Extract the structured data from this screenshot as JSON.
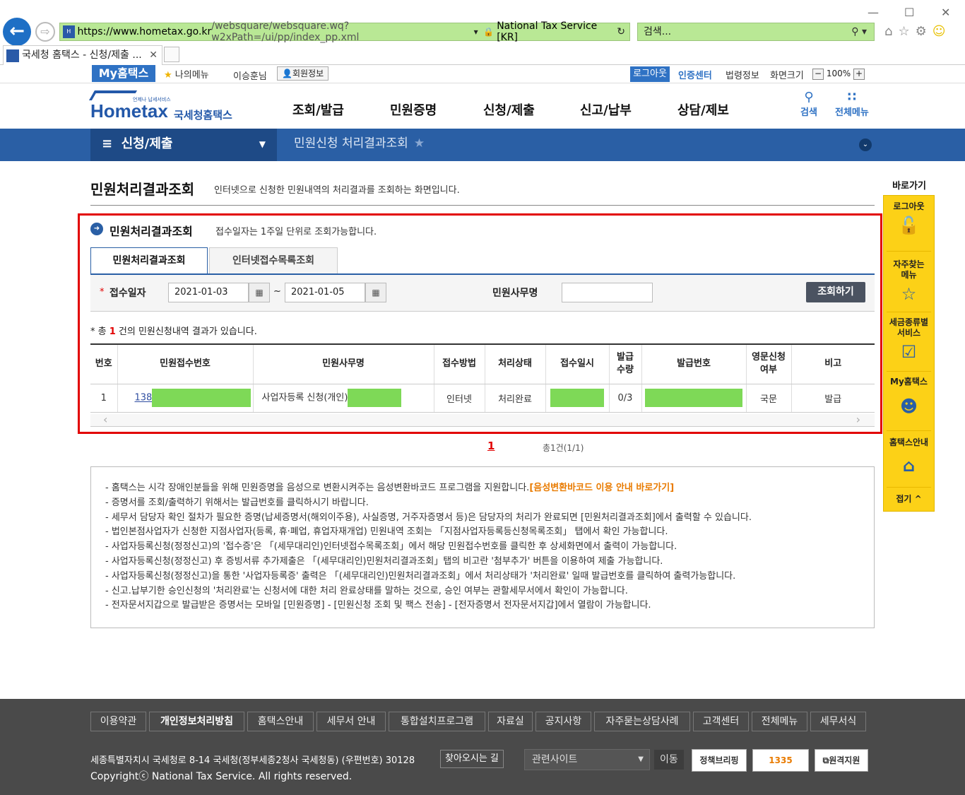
{
  "browser": {
    "url_base": "https://www.hometax.go.kr",
    "url_rest": "/websquare/websquare.wq?w2xPath=/ui/pp/index_pp.xml",
    "site_id": "National Tax Service [KR]",
    "search_placeholder": "검색...",
    "tab_title": "국세청 홈택스 - 신청/제출 ..."
  },
  "util": {
    "myhome": "My홈택스",
    "mymenu": "나의메뉴",
    "username": "이승훈님",
    "member_info": "회원정보",
    "logout": "로그아웃",
    "cert_center": "인증센터",
    "law_info": "법령정보",
    "screen_size": "화면크기",
    "zoom": "100%"
  },
  "header": {
    "logo_main": "Hometax",
    "logo_kr": "국세청홈택스",
    "logo_tiny": "언제나 납세서비스",
    "nav": [
      "조회/발급",
      "민원증명",
      "신청/제출",
      "신고/납부",
      "상담/제보"
    ],
    "search": "검색",
    "all_menu": "전체메뉴"
  },
  "location": {
    "section": "신청/제출",
    "page": "민원신청 처리결과조회"
  },
  "page": {
    "title": "민원처리결과조회",
    "desc": "인터넷으로 신청한 민원내역의 처리결과를 조회하는 화면입니다."
  },
  "section": {
    "title": "민원처리결과조회",
    "note": "접수일자는 1주일 단위로 조회가능합니다.",
    "tabs": [
      "민원처리결과조회",
      "인터넷접수목록조회"
    ],
    "form": {
      "date_label": "접수일자",
      "date_from": "2021-01-03",
      "date_to": "2021-01-05",
      "tilde": "~",
      "task_label": "민원사무명",
      "task_value": "",
      "search_btn": "조회하기"
    },
    "result": {
      "prefix": "* 총",
      "count": "1",
      "suffix": "건의 민원신청내역 결과가 있습니다."
    },
    "table": {
      "headers": [
        "번호",
        "민원접수번호",
        "민원사무명",
        "접수방법",
        "처리상태",
        "접수일시",
        "발급\n수량",
        "발급번호",
        "영문신청\n여부",
        "비고"
      ],
      "rows": [
        {
          "no": "1",
          "receipt_no": "138",
          "task": "사업자등록 신청(개인)",
          "method": "인터넷",
          "status": "처리완료",
          "qty": "0/3",
          "english": "국문",
          "note": "발급"
        }
      ]
    },
    "pager": {
      "current": "1",
      "info": "총1건(1/1)"
    }
  },
  "notes": [
    "- 홈택스는 시각 장애인분들을 위해 민원증명을 음성으로 변환시켜주는 음성변환바코드 프로그램을 지원합니다.",
    "[음성변환바코드 이용 안내 바로가기]",
    "- 증명서를 조회/출력하기 위해서는 발급번호를 클릭하시기 바랍니다.",
    "- 세무서 담당자 확인 절차가 필요한 증명(납세증명서(해외이주용), 사실증명, 거주자증명서 등)은 담당자의 처리가 완료되면 [민원처리결과조회]에서 출력할 수 있습니다.",
    "- 법인본점사업자가 신청한 지점사업자(등록, 휴·폐업, 휴업자재개업) 민원내역 조회는 「지점사업자등록등신청목록조회」 탭에서 확인 가능합니다.",
    "- 사업자등록신청(정정신고)의 '접수증'은 「(세무대리인)인터넷접수목록조회」에서 해당 민원접수번호를 클릭한 후 상세화면에서 출력이 가능합니다.",
    "- 사업자등록신청(정정신고) 후 증빙서류 추가제출은 「(세무대리인)민원처리결과조회」탭의 비고란 '첨부추가' 버튼을 이용하여 제출 가능합니다.",
    "- 사업자등록신청(정정신고)을 통한 '사업자등록증' 출력은 「(세무대리인)민원처리결과조회」에서 처리상태가 '처리완료' 일때 발급번호를 클릭하여 출력가능합니다.",
    "- 신고.납부기한 승인신청의 '처리완료'는 신청서에 대한 처리 완료상태를 말하는 것으로, 승인 여부는 관할세무서에서 확인이 가능합니다.",
    "- 전자문서지갑으로 발급받은 증명서는 모바일 [민원증명] - [민원신청 조회 및 팩스 전송] - [전자증명서 전자문서지갑]에서 열람이 가능합니다."
  ],
  "quick": {
    "title": "바로가기",
    "items": [
      "로그아웃",
      "자주찾는\n메뉴",
      "세금종류별\n서비스",
      "My홈택스",
      "홈택스안내"
    ],
    "collapse": "접기 ^"
  },
  "footer": {
    "links": [
      "이용약관",
      "개인정보처리방침",
      "홈택스안내",
      "세무서 안내",
      "통합설치프로그램",
      "자료실",
      "공지사항",
      "자주묻는상담사례",
      "고객센터",
      "전체메뉴",
      "세무서식"
    ],
    "address": "세종특별자치시 국세청로 8-14 국세청(정부세종2청사 국세청동) (우편번호) 30128",
    "find_way": "찾아오시는 길",
    "copyright": "Copyrightⓒ National Tax Service. All rights reserved.",
    "related": "관련사이트",
    "go": "이동",
    "banners": [
      "정책브리핑",
      "1335",
      "원격지원"
    ]
  }
}
